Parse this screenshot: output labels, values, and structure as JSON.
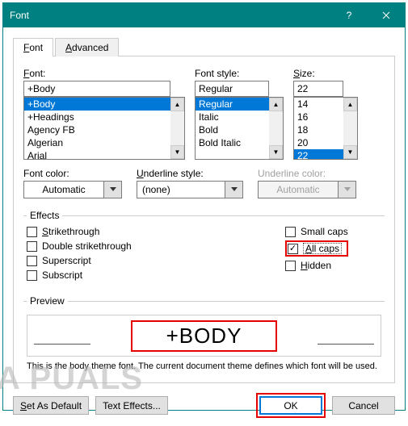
{
  "title": "Font",
  "tabs": {
    "font": "Font",
    "advanced": "Advanced"
  },
  "labels": {
    "font": "Font:",
    "fontStyle": "Font style:",
    "size": "Size:",
    "fontColor": "Font color:",
    "underlineStyle": "Underline style:",
    "underlineColor": "Underline color:"
  },
  "values": {
    "font": "+Body",
    "fontStyle": "Regular",
    "size": "22",
    "fontColor": "Automatic",
    "underlineStyle": "(none)",
    "underlineColor": "Automatic"
  },
  "fontList": [
    "+Body",
    "+Headings",
    "Agency FB",
    "Algerian",
    "Arial"
  ],
  "fontStyleList": [
    "Regular",
    "Italic",
    "Bold",
    "Bold Italic"
  ],
  "sizeList": [
    "14",
    "16",
    "18",
    "20",
    "22"
  ],
  "effects": {
    "legend": "Effects",
    "strikethrough": "Strikethrough",
    "doubleStrikethrough": "Double strikethrough",
    "superscript": "Superscript",
    "subscript": "Subscript",
    "smallCaps": "Small caps",
    "allCaps": "All caps",
    "hidden": "Hidden"
  },
  "preview": {
    "legend": "Preview",
    "text": "+BODY",
    "desc": "This is the body theme font. The current document theme defines which font will be used."
  },
  "buttons": {
    "setDefault": "Set As Default",
    "textEffects": "Text Effects...",
    "ok": "OK",
    "cancel": "Cancel"
  },
  "watermark": "A     PUALS"
}
